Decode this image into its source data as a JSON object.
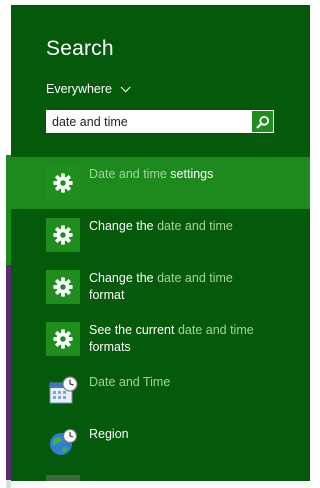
{
  "search": {
    "title": "Search",
    "scope": "Everywhere",
    "query": "date and time"
  },
  "colors": {
    "pane_background": "#05590a",
    "selected_row": "#1e8a1e",
    "icon_tile": "#1f8e1f",
    "dim_text": "#9fd49f"
  },
  "results": [
    {
      "icon": "gear-icon",
      "line1": [
        {
          "text": "Date and time ",
          "dim": true
        },
        {
          "text": "settings",
          "dim": false
        }
      ],
      "line2": [],
      "selected": true
    },
    {
      "icon": "gear-icon",
      "line1": [
        {
          "text": "Change the ",
          "dim": false
        },
        {
          "text": "date and time",
          "dim": true
        }
      ],
      "line2": [],
      "selected": false
    },
    {
      "icon": "gear-icon",
      "line1": [
        {
          "text": "Change the ",
          "dim": false
        },
        {
          "text": "date and time",
          "dim": true
        }
      ],
      "line2": [
        {
          "text": "format",
          "dim": false
        }
      ],
      "selected": false
    },
    {
      "icon": "gear-icon",
      "line1": [
        {
          "text": "See the current ",
          "dim": false
        },
        {
          "text": "date and time",
          "dim": true
        }
      ],
      "line2": [
        {
          "text": "formats",
          "dim": false
        }
      ],
      "selected": false
    },
    {
      "icon": "calendar-clock-icon",
      "line1": [
        {
          "text": "Date and Time",
          "dim": true
        }
      ],
      "line2": [],
      "selected": false
    },
    {
      "icon": "globe-clock-icon",
      "line1": [
        {
          "text": "Region",
          "dim": false
        }
      ],
      "line2": [],
      "selected": false
    }
  ]
}
